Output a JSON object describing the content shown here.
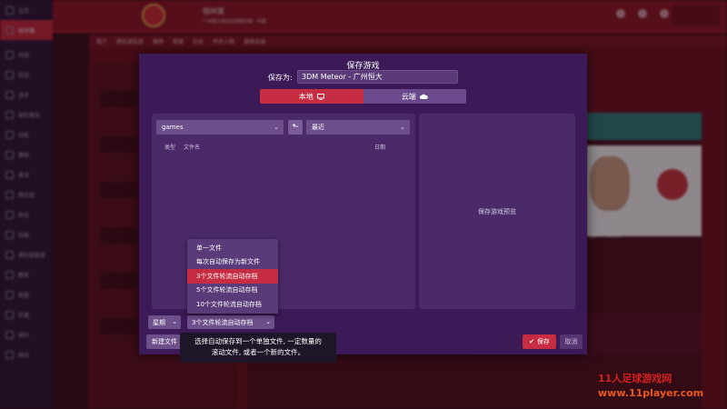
{
  "background": {
    "sidebar_items": [
      "主页",
      "收件箱",
      "阵容",
      "阵容",
      "战术",
      "球队报告",
      "训练",
      "赛程",
      "青训",
      "俱乐部",
      "转会",
      "财政",
      "俱乐部愿景",
      "教练",
      "联盟",
      "外援",
      "简历",
      "网站"
    ],
    "club_name": "恒州某",
    "club_sub": "广州恒大淘宝足球俱乐部 · 中超",
    "tabs": [
      "简介",
      "俱乐部信息",
      "赛季",
      "荣誉",
      "历史",
      "传奇人物",
      "基础设施"
    ],
    "player_name": "3DM Meteor"
  },
  "dialog": {
    "title": "保存游戏",
    "save_as_label": "保存为:",
    "save_as_value": "3DM Meteor - 广州恒大",
    "location_tabs": {
      "local": "本地",
      "cloud": "云端"
    },
    "folder_select": "games",
    "sort_select": "最近",
    "columns": {
      "type": "类型",
      "filename": "文件名",
      "date": "日期"
    },
    "preview_label": "保存游戏预览",
    "frequency_select": "星期",
    "autosave_mode_select": "3个文件轮流自动存档",
    "new_file_button": "新建文件",
    "save_button": "保存",
    "cancel_button": "取消",
    "autosave_options": [
      "单一文件",
      "每次自动保存为新文件",
      "3个文件轮流自动存档",
      "5个文件轮流自动存档",
      "10个文件轮流自动存档"
    ],
    "tooltip_line1": "选择自动保存到一个单独文件, 一定数量的",
    "tooltip_line2": "滚动文件, 或者一个新的文件。"
  },
  "watermark": {
    "line1": "11人足球游戏网",
    "line2": "www.11player.com"
  },
  "colors": {
    "accent": "#c62d42",
    "dialog_bg": "#3c1a57",
    "panel_bg": "#4a2a69"
  }
}
